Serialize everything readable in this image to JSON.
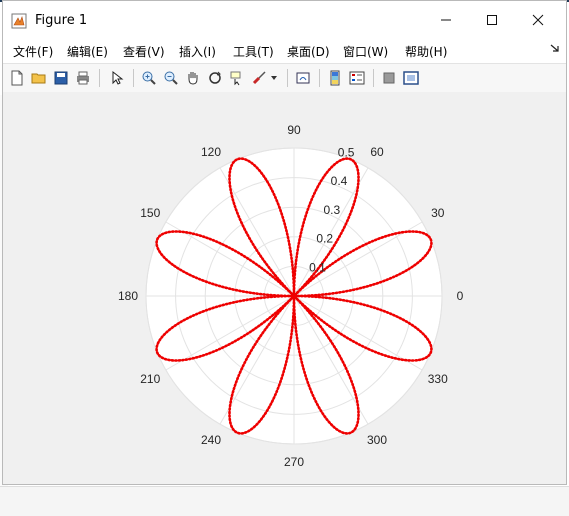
{
  "window": {
    "title": "Figure 1",
    "controls": {
      "minimize": "—",
      "maximize": "☐",
      "close": "✕"
    }
  },
  "menubar": {
    "items": [
      "文件(F)",
      "编辑(E)",
      "查看(V)",
      "插入(I)",
      "工具(T)",
      "桌面(D)",
      "窗口(W)",
      "帮助(H)"
    ],
    "dock_icon": "dock-arrow-icon"
  },
  "toolbar": {
    "icons": [
      "new-figure-icon",
      "open-folder-icon",
      "save-icon",
      "print-icon",
      "select-arrow-icon",
      "zoom-in-icon",
      "zoom-out-icon",
      "pan-hand-icon",
      "rotate-3d-icon",
      "data-cursor-icon",
      "brush-icon",
      "brush-dropdown-icon",
      "link-plot-icon",
      "colorbar-icon",
      "legend-icon",
      "hide-plot-tools-icon",
      "show-plot-tools-icon"
    ]
  },
  "chart_data": {
    "type": "polar-line",
    "angle_ticks_deg": [
      0,
      30,
      60,
      90,
      120,
      150,
      180,
      210,
      240,
      270,
      300,
      330
    ],
    "radial_ticks": [
      0.1,
      0.2,
      0.3,
      0.4,
      0.5
    ],
    "rlim": [
      0,
      0.5
    ],
    "equation_shape": "r = 0.5·|sin(4θ)|",
    "petals": 8,
    "max_r": 0.5,
    "series": [
      {
        "color": "#ee0000",
        "style": "dotted"
      }
    ],
    "grid": true,
    "angle_label_unit": "degrees"
  }
}
